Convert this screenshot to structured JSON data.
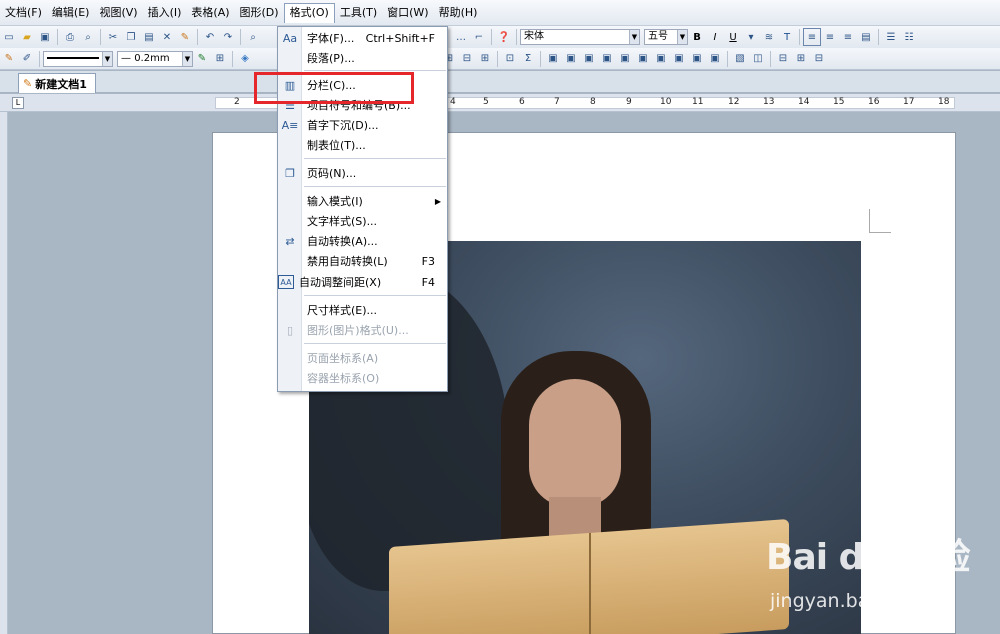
{
  "menubar": {
    "items": [
      "文档(F)",
      "编辑(E)",
      "视图(V)",
      "插入(I)",
      "表格(A)",
      "图形(D)",
      "格式(O)",
      "工具(T)",
      "窗口(W)",
      "帮助(H)"
    ],
    "active_index": 6
  },
  "toolbar1": {
    "font_name": "宋体",
    "font_size": "五号",
    "bold": "B",
    "italic": "I",
    "underline": "U"
  },
  "toolbar2": {
    "line_width": "0.2mm"
  },
  "tabs": [
    {
      "label": "新建文档1"
    }
  ],
  "ruler": {
    "numbers": [
      "2",
      "4",
      "5",
      "6",
      "7",
      "8",
      "9",
      "10",
      "11",
      "12",
      "13",
      "14",
      "15",
      "16",
      "17",
      "18"
    ]
  },
  "format_menu": {
    "items": [
      {
        "label": "字体(F)...",
        "shortcut": "Ctrl+Shift+F",
        "icon": "font-icon"
      },
      {
        "label": "段落(P)...",
        "shortcut": "",
        "icon": ""
      },
      {
        "label": "分栏(C)...",
        "shortcut": "",
        "icon": "columns-icon"
      },
      {
        "label": "项目符号和编号(B)...",
        "shortcut": "",
        "icon": "bullets-icon"
      },
      {
        "label": "首字下沉(D)...",
        "shortcut": "",
        "icon": "dropcap-icon"
      },
      {
        "label": "制表位(T)...",
        "shortcut": "",
        "icon": ""
      },
      {
        "label": "页码(N)...",
        "shortcut": "",
        "icon": "page-number-icon"
      },
      {
        "label": "输入模式(I)",
        "shortcut": "",
        "icon": "",
        "submenu": true
      },
      {
        "label": "文字样式(S)...",
        "shortcut": "",
        "icon": ""
      },
      {
        "label": "自动转换(A)...",
        "shortcut": "",
        "icon": "auto-convert-icon"
      },
      {
        "label": "禁用自动转换(L)",
        "shortcut": "F3",
        "icon": ""
      },
      {
        "label": "自动调整间距(X)",
        "shortcut": "F4",
        "icon": "spacing-icon"
      },
      {
        "label": "尺寸样式(E)...",
        "shortcut": "",
        "icon": ""
      },
      {
        "label": "图形(图片)格式(U)...",
        "shortcut": "",
        "icon": "image-format-icon",
        "disabled": true
      },
      {
        "label": "页面坐标系(A)",
        "shortcut": "",
        "icon": "",
        "disabled": true
      },
      {
        "label": "容器坐标系(O)",
        "shortcut": "",
        "icon": "",
        "disabled": true
      }
    ]
  },
  "watermark": {
    "brand": "Bai du 经验",
    "url": "jingyan.baidu.com"
  },
  "colors": {
    "highlight": "#e5262a",
    "menu_border": "#8a9bb2",
    "page_bg": "#a9b6c4"
  }
}
